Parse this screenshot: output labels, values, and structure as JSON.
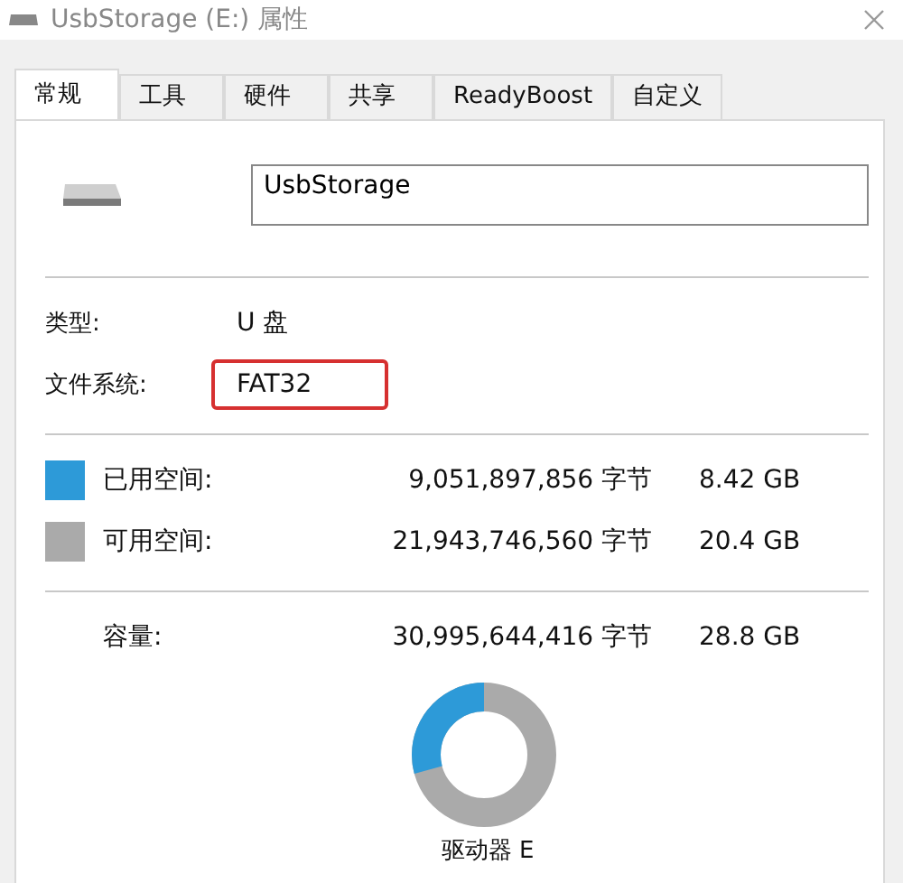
{
  "window": {
    "title": "UsbStorage (E:) 属性"
  },
  "tabs": [
    {
      "label": "常规",
      "selected": true
    },
    {
      "label": "工具",
      "selected": false
    },
    {
      "label": "硬件",
      "selected": false
    },
    {
      "label": "共享",
      "selected": false
    },
    {
      "label": "ReadyBoost",
      "selected": false
    },
    {
      "label": "自定义",
      "selected": false
    }
  ],
  "name_field": {
    "value": "UsbStorage"
  },
  "properties": [
    {
      "label": "类型:",
      "value": "U 盘",
      "highlighted": false
    },
    {
      "label": "文件系统:",
      "value": "FAT32",
      "highlighted": true
    }
  ],
  "space": [
    {
      "label": "已用空间:",
      "bytes": "9,051,897,856 字节",
      "size": "8.42 GB",
      "color": "#2d9ad8"
    },
    {
      "label": "可用空间:",
      "bytes": "21,943,746,560 字节",
      "size": "20.4 GB",
      "color": "#aaaaaa"
    }
  ],
  "capacity": {
    "label": "容量:",
    "bytes": "30,995,644,416 字节",
    "size": "28.8 GB"
  },
  "usage": {
    "level": 0.292
  },
  "drive_label": "驱动器 E"
}
